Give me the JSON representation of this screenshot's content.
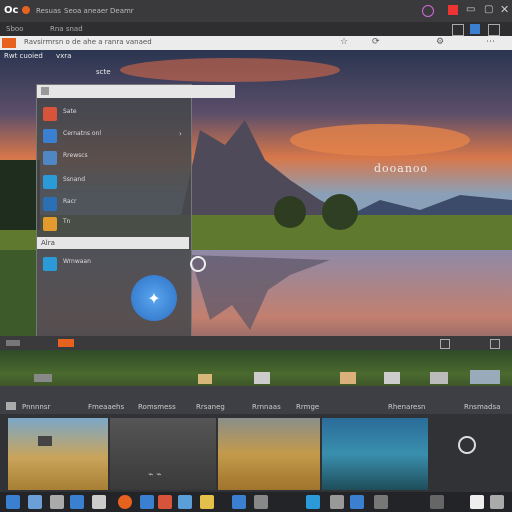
{
  "titlebar": {
    "app_name": "Oc",
    "menu": [
      "Resuas",
      "Seoa aneaer",
      "Deamr"
    ]
  },
  "subbar": {
    "crumbs": [
      "Sboo",
      "Rna snad"
    ]
  },
  "addressbar": {
    "url": "Ravsirmrsn o de ahe a ranra vanaed"
  },
  "wallpaper_labels": {
    "left": "Rwt cuoied",
    "mid": "vxra",
    "far": "scte"
  },
  "panel": {
    "title": "",
    "items": [
      {
        "label": "Sate"
      },
      {
        "label": "Cernatns onl"
      },
      {
        "label": "Rrewscs"
      },
      {
        "label": "Ssnand"
      },
      {
        "label": "Racr"
      },
      {
        "label": "Tn"
      }
    ],
    "section_header": "Alra",
    "section_item": "Wrnwaan"
  },
  "overlay_title": "dooanoo",
  "gallery_bar": {
    "labels": [
      "Pnnnnsr",
      "Fmeaaehs",
      "Romsmess",
      "Rrsaneg",
      "Rrnnaas",
      "Rrmge",
      "Rhenaresn",
      "Rnsmadsa"
    ]
  },
  "colors": {
    "accent": "#3a7fd0",
    "orange": "#e8621f",
    "panel": "#46484c"
  }
}
